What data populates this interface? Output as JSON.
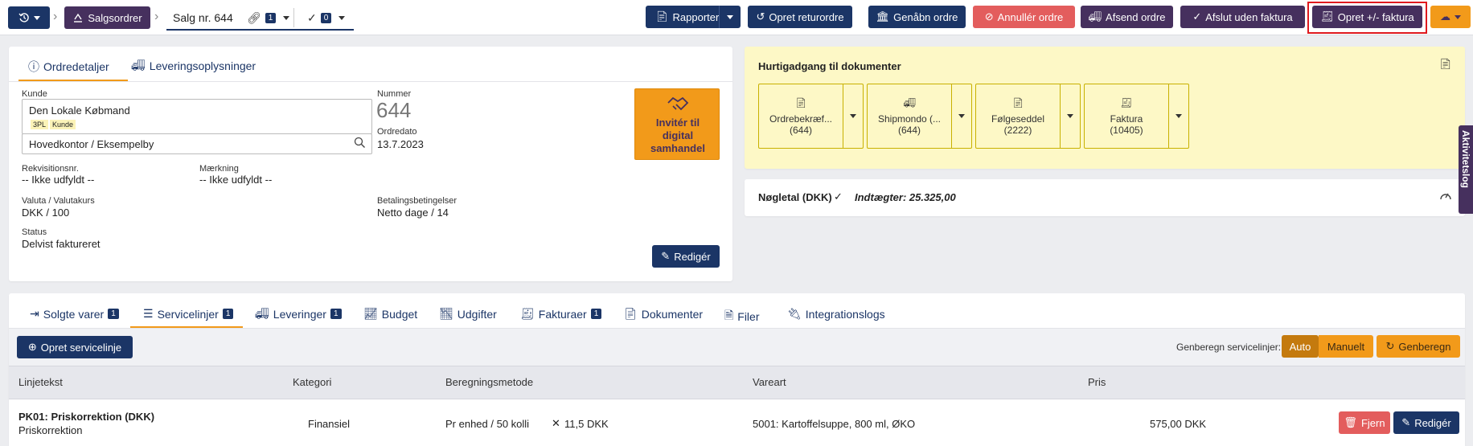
{
  "topbar": {
    "history_button": "history",
    "breadcrumb_parent": "Salgsordrer",
    "breadcrumb_current": "Salg nr. 644",
    "link_count": "1",
    "check_count": "0",
    "actions": {
      "reports": "Rapporter",
      "create_return": "Opret returordre",
      "reopen": "Genåbn ordre",
      "cancel": "Annullér ordre",
      "send": "Afsend ordre",
      "close_no_invoice": "Afslut uden faktura",
      "create_invoice": "Opret +/- faktura"
    }
  },
  "order_card": {
    "tabs": [
      "Ordredetaljer",
      "Leveringsoplysninger"
    ],
    "customer_label": "Kunde",
    "customer_name": "Den Lokale Købmand",
    "customer_tags": [
      "3PL",
      "Kunde"
    ],
    "address": "Hovedkontor / Eksempelby",
    "number_label": "Nummer",
    "number_value": "644",
    "order_date_label": "Ordredato",
    "order_date_value": "13.7.2023",
    "invite_text": "Invitér til digital samhandel",
    "requisition_label": "Rekvisitionsnr.",
    "requisition_value": "-- Ikke udfyldt --",
    "marking_label": "Mærkning",
    "marking_value": "-- Ikke udfyldt --",
    "currency_label": "Valuta / Valutakurs",
    "currency_value": "DKK / 100",
    "payment_label": "Betalingsbetingelser",
    "payment_value": "Netto dage / 14",
    "status_label": "Status",
    "status_value": "Delvist faktureret",
    "edit_button": "Redigér"
  },
  "quick_access": {
    "title": "Hurtigadgang til dokumenter",
    "docs": [
      {
        "name": "Ordrebekræf...",
        "count": "(644)"
      },
      {
        "name": "Shipmondo (...",
        "count": "(644)"
      },
      {
        "name": "Følgeseddel",
        "count": "(2222)"
      },
      {
        "name": "Faktura",
        "count": "(10405)"
      }
    ]
  },
  "key_figures": {
    "title": "Nøgletal (DKK)",
    "revenue": "Indtægter: 25.325,00"
  },
  "side_tab": "Aktivitetslog",
  "bottom": {
    "tabs": [
      {
        "label": "Solgte varer",
        "badge": "1"
      },
      {
        "label": "Servicelinjer",
        "badge": "1"
      },
      {
        "label": "Leveringer",
        "badge": "1"
      },
      {
        "label": "Budget",
        "badge": ""
      },
      {
        "label": "Udgifter",
        "badge": ""
      },
      {
        "label": "Fakturaer",
        "badge": "1"
      },
      {
        "label": "Dokumenter",
        "badge": ""
      },
      {
        "label": "Filer",
        "badge": ""
      },
      {
        "label": "Integrationslogs",
        "badge": ""
      }
    ],
    "create_button": "Opret servicelinje",
    "recalc_label": "Genberegn servicelinjer:",
    "mode_auto": "Auto",
    "mode_manual": "Manuelt",
    "recalc_button": "Genberegn",
    "table": {
      "headers": [
        "Linjetekst",
        "Kategori",
        "Beregningsmetode",
        "Vareart",
        "Pris"
      ],
      "rows": [
        {
          "title": "PK01: Priskorrektion (DKK)",
          "subtitle": "Priskorrektion",
          "category": "Finansiel",
          "method_a": "Pr enhed / 50 kolli",
          "method_b": "11,5 DKK",
          "item_type": "5001: Kartoffelsuppe, 800 ml, ØKO",
          "price": "575,00 DKK",
          "remove": "Fjern",
          "edit": "Redigér"
        }
      ]
    }
  },
  "colors": {
    "navy": "#1b3566",
    "purple": "#46305e",
    "red": "#e35d5d",
    "orange": "#f29a1a",
    "yellow_panel": "#fdf8c6"
  }
}
